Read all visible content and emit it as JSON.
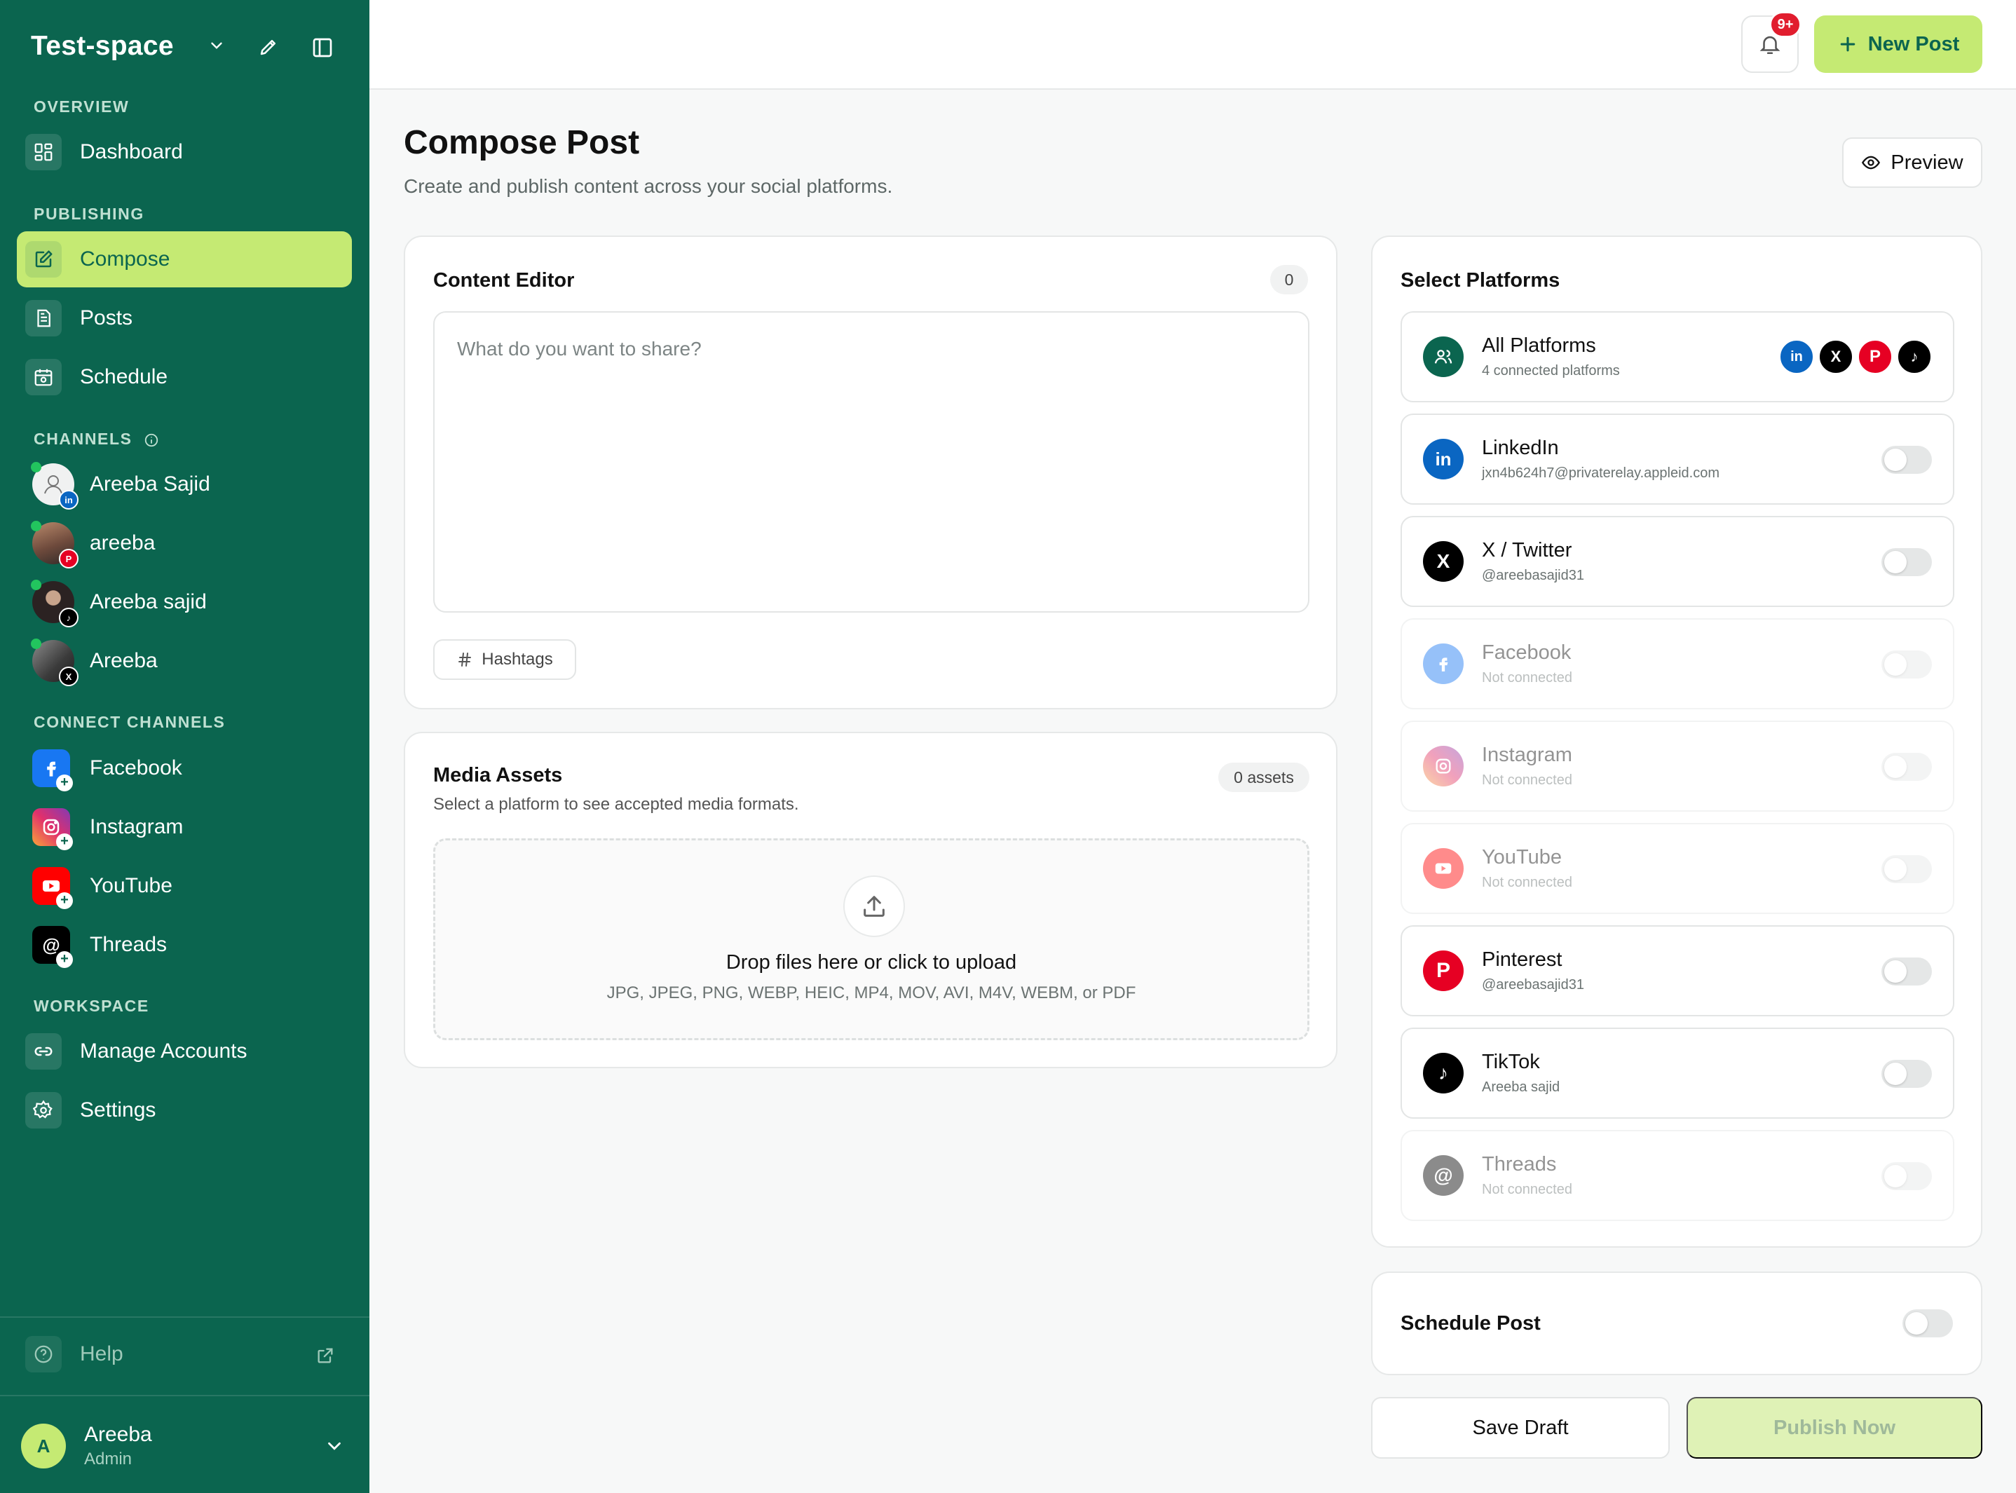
{
  "sidebar": {
    "workspace": "Test-space",
    "sections": {
      "overview": "OVERVIEW",
      "publishing": "PUBLISHING",
      "channels": "CHANNELS",
      "connect": "CONNECT CHANNELS",
      "workspace": "WORKSPACE"
    },
    "nav": {
      "dashboard": "Dashboard",
      "compose": "Compose",
      "posts": "Posts",
      "schedule": "Schedule",
      "manage": "Manage Accounts",
      "settings": "Settings"
    },
    "channels": [
      {
        "name": "Areeba Sajid",
        "platform": "linkedin"
      },
      {
        "name": "areeba",
        "platform": "pinterest"
      },
      {
        "name": "Areeba sajid",
        "platform": "tiktok"
      },
      {
        "name": "Areeba",
        "platform": "x"
      }
    ],
    "connect": [
      "Facebook",
      "Instagram",
      "YouTube",
      "Threads"
    ],
    "help": "Help",
    "user": {
      "initial": "A",
      "name": "Areeba",
      "role": "Admin"
    }
  },
  "topbar": {
    "notif_badge": "9+",
    "new_post": "New Post"
  },
  "page": {
    "title": "Compose Post",
    "subtitle": "Create and publish content across your social platforms.",
    "preview": "Preview"
  },
  "editor": {
    "title": "Content Editor",
    "count": "0",
    "placeholder": "What do you want to share?",
    "value": "",
    "hashtags": "Hashtags"
  },
  "media": {
    "title": "Media Assets",
    "subtitle": "Select a platform to see accepted media formats.",
    "count": "0 assets",
    "drop_title": "Drop files here or click to upload",
    "drop_formats": "JPG, JPEG, PNG, WEBP, HEIC, MP4, MOV, AVI, M4V, WEBM, or PDF"
  },
  "platforms": {
    "title": "Select Platforms",
    "all": {
      "name": "All Platforms",
      "sub": "4 connected platforms"
    },
    "items": [
      {
        "name": "LinkedIn",
        "sub": "jxn4b624h7@privaterelay.appleid.com",
        "connected": true,
        "enabled": false
      },
      {
        "name": "X / Twitter",
        "sub": "@areebasajid31",
        "connected": true,
        "enabled": false
      },
      {
        "name": "Facebook",
        "sub": "Not connected",
        "connected": false,
        "enabled": false
      },
      {
        "name": "Instagram",
        "sub": "Not connected",
        "connected": false,
        "enabled": false
      },
      {
        "name": "YouTube",
        "sub": "Not connected",
        "connected": false,
        "enabled": false
      },
      {
        "name": "Pinterest",
        "sub": "@areebasajid31",
        "connected": true,
        "enabled": false
      },
      {
        "name": "TikTok",
        "sub": "Areeba sajid",
        "connected": true,
        "enabled": false
      },
      {
        "name": "Threads",
        "sub": "Not connected",
        "connected": false,
        "enabled": false
      }
    ]
  },
  "schedule": {
    "title": "Schedule Post",
    "enabled": false
  },
  "actions": {
    "save_draft": "Save Draft",
    "publish": "Publish Now"
  },
  "colors": {
    "sidebar": "#0b654f",
    "accent": "#c5ea73",
    "linkedin": "#0a66c2",
    "x": "#000000",
    "facebook": "#1877f2",
    "instagram": "#e1306c",
    "youtube": "#ff0000",
    "pinterest": "#e60023",
    "tiktok": "#000000",
    "threads": "#000000"
  }
}
